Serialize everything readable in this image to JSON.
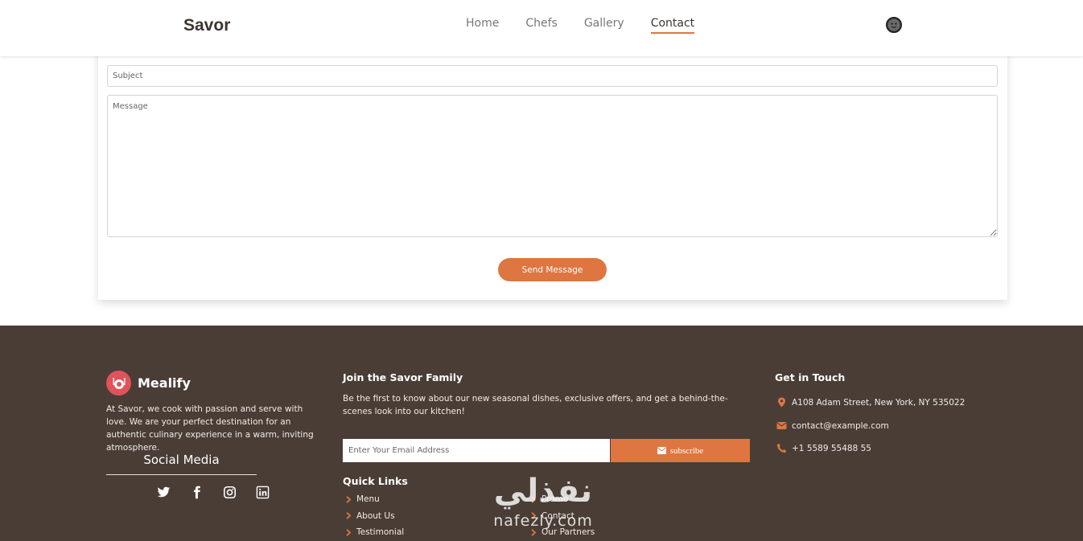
{
  "header": {
    "brand": "Savor",
    "nav": [
      "Home",
      "Chefs",
      "Gallery",
      "Contact"
    ],
    "active_nav": "Contact"
  },
  "form": {
    "subject_placeholder": "Subject",
    "message_placeholder": "Message",
    "send_label": "Send Message"
  },
  "footer": {
    "logo_text": "Mealify",
    "about": "At Savor, we cook with passion and serve with love. We are your perfect destination for an authentic culinary experience in a warm, inviting atmosphere.",
    "social_title": "Social Media",
    "social_icons": [
      "twitter-icon",
      "facebook-icon",
      "instagram-icon",
      "linkedin-icon"
    ],
    "join_title": "Join the Savor Family",
    "join_text": "Be the first to know about our new seasonal dishes, exclusive offers, and get a behind-the-scenes look into our kitchen!",
    "email_placeholder": "Enter Your Email Address",
    "subscribe_label": "subscribe",
    "quick_title": "Quick Links",
    "quick_links_col1": [
      "Menu",
      "About Us",
      "Testimonial"
    ],
    "quick_links_col2": [
      "Promo",
      "Contact",
      "Our Partners"
    ],
    "touch_title": "Get in Touch",
    "address": "A108 Adam Street, New York, NY 535022",
    "email": "contact@example.com",
    "phone": "+1 5589 55488 55"
  },
  "watermark": {
    "arabic": "نفذلي",
    "latin": "nafezly.com"
  },
  "colors": {
    "accent": "#dd7641",
    "footer_bg": "#4a3d36",
    "logo_bg": "#e2525a"
  }
}
